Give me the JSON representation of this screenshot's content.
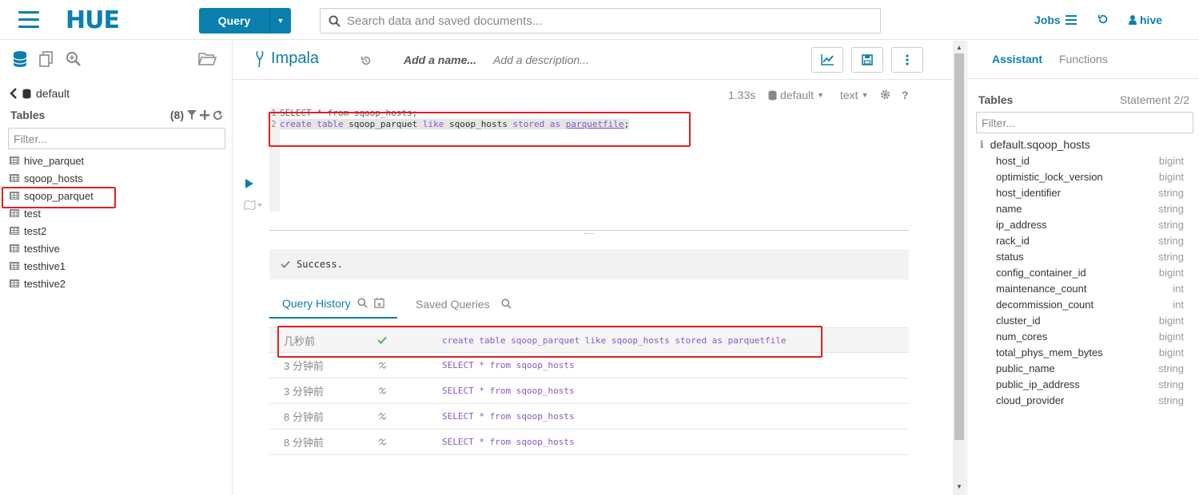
{
  "topbar": {
    "logo": "HUE",
    "query_button": "Query",
    "search_placeholder": "Search data and saved documents...",
    "jobs_label": "Jobs",
    "user_label": "hive"
  },
  "left_panel": {
    "database": "default",
    "tables_label": "Tables",
    "tables_count": "(8)",
    "filter_placeholder": "Filter...",
    "tables": [
      "hive_parquet",
      "sqoop_hosts",
      "sqoop_parquet",
      "test",
      "test2",
      "testhive",
      "testhive1",
      "testhive2"
    ]
  },
  "editor": {
    "engine": "Impala",
    "name_placeholder": "Add a name...",
    "description_placeholder": "Add a description...",
    "exec_time": "1.33s",
    "database": "default",
    "format": "text",
    "line1_num": "1",
    "line1_code": "SELECT * from sqoop_hosts;",
    "line2_num": "2",
    "line2": {
      "kw1": "create",
      "kw2": "table",
      "id1": "sqoop_parquet",
      "kw3": "like",
      "id2": "sqoop_hosts",
      "kw4": "stored",
      "kw5": "as",
      "id3": "parquetfile",
      "end": ";"
    },
    "result_message": "Success."
  },
  "history": {
    "tab_history": "Query History",
    "tab_saved": "Saved Queries",
    "rows": [
      {
        "time": "几秒前",
        "query": "create table sqoop_parquet like sqoop_hosts stored as parquetfile"
      },
      {
        "time": "3 分钟前",
        "query": "SELECT * from sqoop_hosts"
      },
      {
        "time": "3 分钟前",
        "query": "SELECT * from sqoop_hosts"
      },
      {
        "time": "8 分钟前",
        "query": "SELECT * from sqoop_hosts"
      },
      {
        "time": "8 分钟前",
        "query": "SELECT * from sqoop_hosts"
      }
    ]
  },
  "right_panel": {
    "tab_assistant": "Assistant",
    "tab_functions": "Functions",
    "tables_label": "Tables",
    "statement": "Statement 2/2",
    "filter_placeholder": "Filter...",
    "table_name": "default.sqoop_hosts",
    "columns": [
      {
        "name": "host_id",
        "type": "bigint"
      },
      {
        "name": "optimistic_lock_version",
        "type": "bigint"
      },
      {
        "name": "host_identifier",
        "type": "string"
      },
      {
        "name": "name",
        "type": "string"
      },
      {
        "name": "ip_address",
        "type": "string"
      },
      {
        "name": "rack_id",
        "type": "string"
      },
      {
        "name": "status",
        "type": "string"
      },
      {
        "name": "config_container_id",
        "type": "bigint"
      },
      {
        "name": "maintenance_count",
        "type": "int"
      },
      {
        "name": "decommission_count",
        "type": "int"
      },
      {
        "name": "cluster_id",
        "type": "bigint"
      },
      {
        "name": "num_cores",
        "type": "bigint"
      },
      {
        "name": "total_phys_mem_bytes",
        "type": "bigint"
      },
      {
        "name": "public_name",
        "type": "string"
      },
      {
        "name": "public_ip_address",
        "type": "string"
      },
      {
        "name": "cloud_provider",
        "type": "string"
      }
    ]
  },
  "colors": {
    "accent": "#0B7FAD",
    "highlight_border": "#E02020",
    "keyword": "#8A58C5",
    "success": "#5CB85C"
  }
}
